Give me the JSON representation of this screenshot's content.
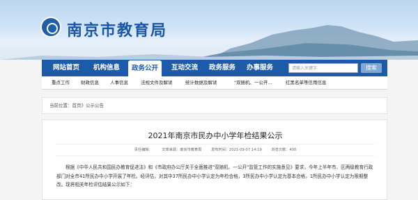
{
  "header": {
    "site_title": "南京市教育局"
  },
  "nav": {
    "items": [
      "网站首页",
      "机构信息",
      "政务公开",
      "互动交流",
      "政务服务",
      "办事服务"
    ],
    "active": "政务公开"
  },
  "search": {
    "placeholder": "请输入关键字",
    "button": "搜索"
  },
  "subnav": [
    "重点工作",
    "财政信息",
    "人事信息",
    "法规文件及解读",
    "统计数据及解读",
    "\"双随机、一公开...",
    "红黑名单等信用信息"
  ],
  "breadcrumb": {
    "prefix": "当前位置：",
    "home": "首页",
    "sep": "》",
    "section": "公示公告"
  },
  "article": {
    "title": "2021年南京市民办中小学年检结果公示",
    "meta": {
      "font_size": "责任编辑：",
      "source": "文章来源：南京市教育局",
      "date": "发布时间：2021-09-07 14:19",
      "views": "浏览次数：400"
    },
    "body": "根据《中华人民共和国民办教育促进法》和《市政府办公厅关于全面推进\"双随机、一公开\"监管工作的实施意见》要求，今年上半年市、区两级教育行政部门对全市41所民办中小学开展了年检。经评估，对其中37所民办中小学认定为年检合格，3所民办中小学认定为基本合格，1所民办中小学认定为限期整改。现将相关年检评估结果公示如下："
  },
  "colors": {
    "brand": "#1d5ba8",
    "title": "#1a56a6"
  }
}
